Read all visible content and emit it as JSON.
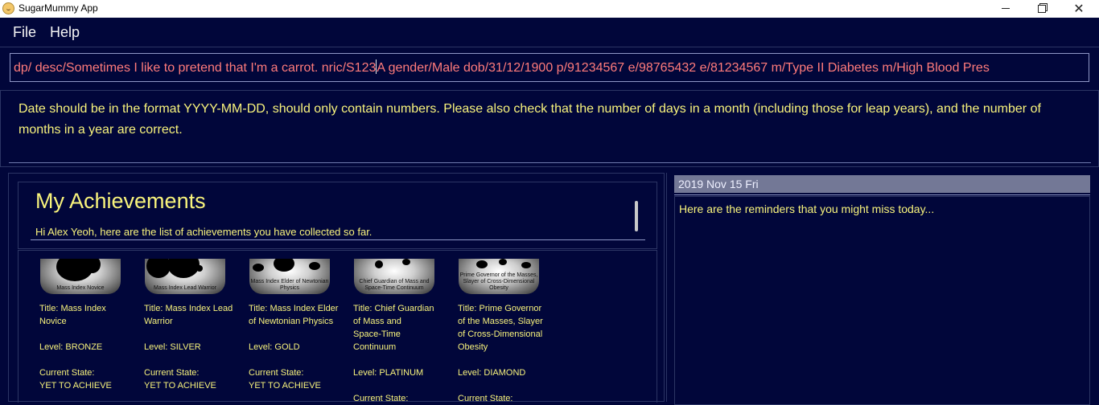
{
  "window": {
    "title": "SugarMummy App",
    "icon": "sugar-mummy-face-icon",
    "controls": {
      "minimize": "minimize-icon",
      "maximize": "restore-icon",
      "close": "✕"
    }
  },
  "menu": {
    "file": "File",
    "help": "Help"
  },
  "command": {
    "before_caret": "dp/  desc/Sometimes I like to pretend that I'm a carrot. nric/S123",
    "after_caret": "A gender/Male dob/31/12/1900 p/91234567 e/98765432 e/81234567 m/Type II Diabetes m/High Blood Pres"
  },
  "result": {
    "message": "Date should be in the format YYYY-MM-DD, should only contain numbers. Please also check that the number of days in a month (including those for leap years), and the number of months in a year are correct."
  },
  "achievements": {
    "title": "My Achievements",
    "subtitle": "Hi Alex Yeoh, here are the list of achievements you have collected so far.",
    "cards": [
      {
        "badge": "Mass Index Novice",
        "title": "Title: Mass Index",
        "title2": "Novice",
        "title3": "",
        "title4": "",
        "level": "Level: BRONZE",
        "state_label": "Current State:",
        "state": "YET TO ACHIEVE"
      },
      {
        "badge": "Mass Index Lead Warrior",
        "title": "Title: Mass Index Lead",
        "title2": "Warrior",
        "title3": "",
        "title4": "",
        "level": "Level: SILVER",
        "state_label": "Current State:",
        "state": "YET TO ACHIEVE"
      },
      {
        "badge": "Mass Index Elder of Newtonian Physics",
        "title": "Title: Mass Index Elder",
        "title2": "of Newtonian Physics",
        "title3": "",
        "title4": "",
        "level": "Level: GOLD",
        "state_label": "Current State:",
        "state": "YET TO ACHIEVE"
      },
      {
        "badge": "Chief Guardian of Mass and Space-Time Continuum",
        "title": "Title: Chief Guardian",
        "title2": "of Mass and",
        "title3": "Space-Time",
        "title4": "Continuum",
        "level": "Level: PLATINUM",
        "state_label": "Current State:",
        "state": ""
      },
      {
        "badge": "Prime Governor of the Masses, Slayer of Cross-Dimensional Obesity",
        "title": "Title: Prime Governor",
        "title2": "of the Masses, Slayer",
        "title3": "of Cross-Dimensional",
        "title4": "Obesity",
        "level": "Level: DIAMOND",
        "state_label": "Current State:",
        "state": ""
      }
    ]
  },
  "reminders": {
    "date": "2019 Nov 15 Fri",
    "message": "Here are the reminders that you might miss today..."
  },
  "colors": {
    "background": "#01063a",
    "accent_text": "#f8f37c",
    "error_text": "#ff7b7b",
    "date_bar": "#737896"
  }
}
